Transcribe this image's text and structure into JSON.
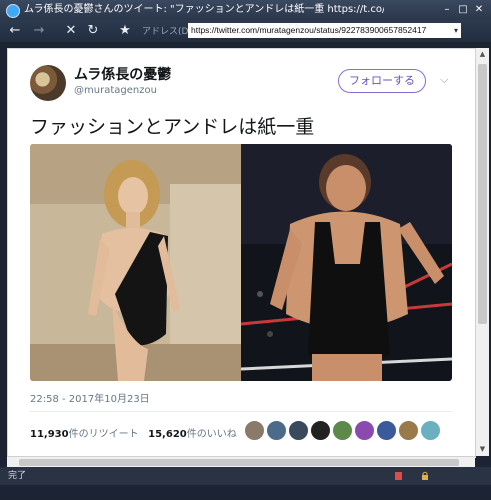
{
  "window": {
    "title": "ムラ係長の憂鬱さんのツイート: \"ファッションとアンドレは紙一重 https://t.co/VMtRAzRrj\""
  },
  "toolbar": {
    "address_label": "アドレス(D)",
    "url": "https://twitter.com/muratagenzou/status/922783900657852417"
  },
  "tweet": {
    "display_name": "ムラ係長の憂鬱",
    "handle": "@muratagenzou",
    "follow_label": "フォローする",
    "text": "ファッションとアンドレは紙一重",
    "timestamp": "22:58 - 2017年10月23日",
    "retweets_count": "11,930",
    "retweets_label": "件のリツイート",
    "likes_count": "15,620",
    "likes_label": "件のいいね"
  },
  "statusbar": {
    "text": "完了"
  },
  "colors": {
    "follow": "#6a4fc4",
    "titlebar": "#2a3649",
    "link_blue": "#3fa9f5"
  }
}
